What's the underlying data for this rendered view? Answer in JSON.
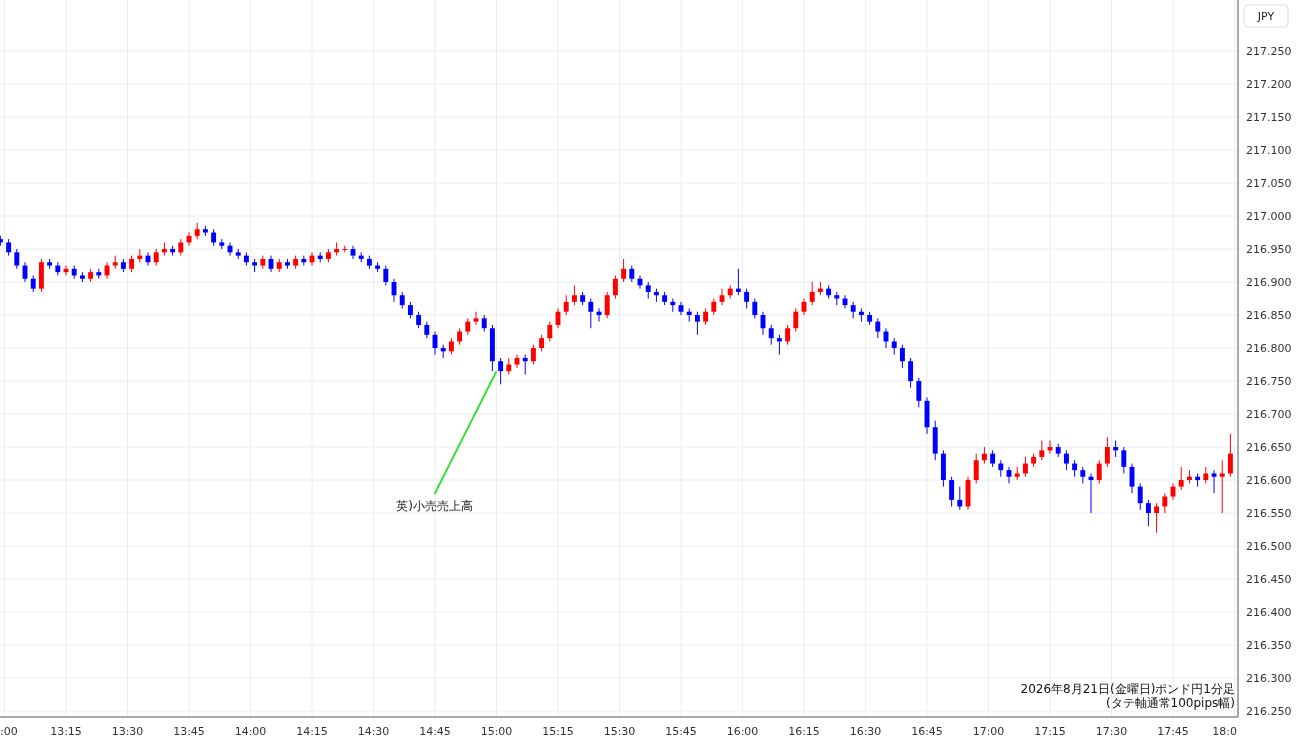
{
  "time_axis": {
    "cut_label": ":00"
  },
  "chart_data": {
    "type": "candlestick",
    "ylabel": "JPY",
    "grid": true,
    "xlim": [
      12.98167,
      18.01417
    ],
    "ylim": [
      216.241,
      217.3273
    ],
    "yticks": [
      {
        "value": 217.25,
        "label": "217.250"
      },
      {
        "value": 217.2,
        "label": "217.200"
      },
      {
        "value": 217.15,
        "label": "217.150"
      },
      {
        "value": 217.1,
        "label": "217.100"
      },
      {
        "value": 217.05,
        "label": "217.050"
      },
      {
        "value": 217.0,
        "label": "217.000"
      },
      {
        "value": 216.95,
        "label": "216.950"
      },
      {
        "value": 216.9,
        "label": "216.900"
      },
      {
        "value": 216.85,
        "label": "216.850"
      },
      {
        "value": 216.8,
        "label": "216.800"
      },
      {
        "value": 216.75,
        "label": "216.750"
      },
      {
        "value": 216.7,
        "label": "216.700"
      },
      {
        "value": 216.65,
        "label": "216.650"
      },
      {
        "value": 216.6,
        "label": "216.600"
      },
      {
        "value": 216.55,
        "label": "216.550"
      },
      {
        "value": 216.5,
        "label": "216.500"
      },
      {
        "value": 216.45,
        "label": "216.450"
      },
      {
        "value": 216.4,
        "label": "216.400"
      },
      {
        "value": 216.35,
        "label": "216.350"
      },
      {
        "value": 216.3,
        "label": "216.300"
      },
      {
        "value": 216.25,
        "label": "216.250"
      }
    ],
    "xticks": [
      {
        "value": 13.25,
        "label": "13:15"
      },
      {
        "value": 13.5,
        "label": "13:30"
      },
      {
        "value": 13.75,
        "label": "13:45"
      },
      {
        "value": 14,
        "label": "14:00"
      },
      {
        "value": 14.25,
        "label": "14:15"
      },
      {
        "value": 14.5,
        "label": "14:30"
      },
      {
        "value": 14.75,
        "label": "14:45"
      },
      {
        "value": 15,
        "label": "15:00"
      },
      {
        "value": 15.25,
        "label": "15:15"
      },
      {
        "value": 15.5,
        "label": "15:30"
      },
      {
        "value": 15.75,
        "label": "15:45"
      },
      {
        "value": 16,
        "label": "16:00"
      },
      {
        "value": 16.25,
        "label": "16:15"
      },
      {
        "value": 16.5,
        "label": "16:30"
      },
      {
        "value": 16.75,
        "label": "16:45"
      },
      {
        "value": 17,
        "label": "17:00"
      },
      {
        "value": 17.25,
        "label": "17:15"
      },
      {
        "value": 17.5,
        "label": "17:30"
      },
      {
        "value": 17.75,
        "label": "17:45"
      },
      {
        "value": 18,
        "label": "18:0"
      }
    ],
    "x": [
      12.9833,
      13.0167,
      13.05,
      13.0833,
      13.1167,
      13.15,
      13.1833,
      13.2167,
      13.25,
      13.2833,
      13.3167,
      13.35,
      13.3833,
      13.4167,
      13.45,
      13.4833,
      13.5167,
      13.55,
      13.5833,
      13.6167,
      13.65,
      13.6833,
      13.7167,
      13.75,
      13.7833,
      13.8167,
      13.85,
      13.8833,
      13.9167,
      13.95,
      13.9833,
      14.0167,
      14.05,
      14.0833,
      14.1167,
      14.15,
      14.1833,
      14.2167,
      14.25,
      14.2833,
      14.3167,
      14.35,
      14.3833,
      14.4167,
      14.45,
      14.4833,
      14.5167,
      14.55,
      14.5833,
      14.6167,
      14.65,
      14.6833,
      14.7167,
      14.75,
      14.7833,
      14.8167,
      14.85,
      14.8833,
      14.9167,
      14.95,
      14.9833,
      15.0167,
      15.05,
      15.0833,
      15.1167,
      15.15,
      15.1833,
      15.2167,
      15.25,
      15.2833,
      15.3167,
      15.35,
      15.3833,
      15.4167,
      15.45,
      15.4833,
      15.5167,
      15.55,
      15.5833,
      15.6167,
      15.65,
      15.6833,
      15.7167,
      15.75,
      15.7833,
      15.8167,
      15.85,
      15.8833,
      15.9167,
      15.95,
      15.9833,
      16.0167,
      16.05,
      16.0833,
      16.1167,
      16.15,
      16.1833,
      16.2167,
      16.25,
      16.2833,
      16.3167,
      16.35,
      16.3833,
      16.4167,
      16.45,
      16.4833,
      16.5167,
      16.55,
      16.5833,
      16.6167,
      16.65,
      16.6833,
      16.7167,
      16.75,
      16.7833,
      16.8167,
      16.85,
      16.8833,
      16.9167,
      16.95,
      16.9833,
      17.0167,
      17.05,
      17.0833,
      17.1167,
      17.15,
      17.1833,
      17.2167,
      17.25,
      17.2833,
      17.3167,
      17.35,
      17.3833,
      17.4167,
      17.45,
      17.4833,
      17.5167,
      17.55,
      17.5833,
      17.6167,
      17.65,
      17.6833,
      17.7167,
      17.75,
      17.7833,
      17.8167,
      17.85,
      17.8833,
      17.9167,
      17.95,
      17.9833
    ],
    "ohlc": [
      [
        216.965,
        216.97,
        216.955,
        216.96
      ],
      [
        216.96,
        216.965,
        216.94,
        216.945
      ],
      [
        216.945,
        216.95,
        216.92,
        216.925
      ],
      [
        216.925,
        216.93,
        216.9,
        216.905
      ],
      [
        216.905,
        216.91,
        216.885,
        216.89
      ],
      [
        216.89,
        216.935,
        216.885,
        216.93
      ],
      [
        216.93,
        216.935,
        216.92,
        216.925
      ],
      [
        216.925,
        216.93,
        216.91,
        216.915
      ],
      [
        216.915,
        216.925,
        216.91,
        216.92
      ],
      [
        216.92,
        216.925,
        216.905,
        216.91
      ],
      [
        216.91,
        216.915,
        216.9,
        216.905
      ],
      [
        216.905,
        216.92,
        216.9,
        216.915
      ],
      [
        216.915,
        216.92,
        216.905,
        216.91
      ],
      [
        216.91,
        216.93,
        216.905,
        216.925
      ],
      [
        216.925,
        216.94,
        216.92,
        216.93
      ],
      [
        216.93,
        216.935,
        216.915,
        216.92
      ],
      [
        216.92,
        216.94,
        216.915,
        216.935
      ],
      [
        216.935,
        216.95,
        216.93,
        216.94
      ],
      [
        216.94,
        216.945,
        216.925,
        216.93
      ],
      [
        216.93,
        216.95,
        216.925,
        216.945
      ],
      [
        216.945,
        216.96,
        216.94,
        216.95
      ],
      [
        216.95,
        216.955,
        216.94,
        216.945
      ],
      [
        216.945,
        216.965,
        216.94,
        216.96
      ],
      [
        216.96,
        216.975,
        216.955,
        216.97
      ],
      [
        216.97,
        216.99,
        216.965,
        216.98
      ],
      [
        216.98,
        216.985,
        216.97,
        216.975
      ],
      [
        216.975,
        216.98,
        216.955,
        216.96
      ],
      [
        216.96,
        216.965,
        216.95,
        216.955
      ],
      [
        216.955,
        216.96,
        216.94,
        216.945
      ],
      [
        216.945,
        216.95,
        216.935,
        216.94
      ],
      [
        216.94,
        216.945,
        216.925,
        216.93
      ],
      [
        216.93,
        216.935,
        216.915,
        216.925
      ],
      [
        216.925,
        216.94,
        216.92,
        216.935
      ],
      [
        216.935,
        216.94,
        216.915,
        216.92
      ],
      [
        216.92,
        216.935,
        216.915,
        216.93
      ],
      [
        216.93,
        216.935,
        216.92,
        216.925
      ],
      [
        216.925,
        216.94,
        216.92,
        216.935
      ],
      [
        216.935,
        216.94,
        216.925,
        216.93
      ],
      [
        216.93,
        216.945,
        216.925,
        216.94
      ],
      [
        216.94,
        216.945,
        216.93,
        216.935
      ],
      [
        216.935,
        216.95,
        216.93,
        216.945
      ],
      [
        216.945,
        216.96,
        216.94,
        216.95
      ],
      [
        216.95,
        216.955,
        216.945,
        216.95
      ],
      [
        216.95,
        216.955,
        216.935,
        216.94
      ],
      [
        216.94,
        216.945,
        216.93,
        216.935
      ],
      [
        216.935,
        216.94,
        216.92,
        216.925
      ],
      [
        216.925,
        216.93,
        216.915,
        216.92
      ],
      [
        216.92,
        216.925,
        216.895,
        216.9
      ],
      [
        216.9,
        216.905,
        216.87,
        216.88
      ],
      [
        216.88,
        216.885,
        216.86,
        216.865
      ],
      [
        216.865,
        216.87,
        216.845,
        216.85
      ],
      [
        216.85,
        216.855,
        216.83,
        216.835
      ],
      [
        216.835,
        216.84,
        216.815,
        216.82
      ],
      [
        216.82,
        216.825,
        216.79,
        216.8
      ],
      [
        216.8,
        216.805,
        216.785,
        216.795
      ],
      [
        216.795,
        216.815,
        216.79,
        216.81
      ],
      [
        216.81,
        216.83,
        216.805,
        216.825
      ],
      [
        216.825,
        216.845,
        216.82,
        216.84
      ],
      [
        216.84,
        216.855,
        216.835,
        216.845
      ],
      [
        216.845,
        216.85,
        216.825,
        216.83
      ],
      [
        216.83,
        216.835,
        216.765,
        216.78
      ],
      [
        216.78,
        216.785,
        216.745,
        216.765
      ],
      [
        216.765,
        216.785,
        216.76,
        216.775
      ],
      [
        216.775,
        216.79,
        216.77,
        216.785
      ],
      [
        216.785,
        216.79,
        216.76,
        216.78
      ],
      [
        216.78,
        216.805,
        216.775,
        216.8
      ],
      [
        216.8,
        216.82,
        216.795,
        216.815
      ],
      [
        216.815,
        216.84,
        216.81,
        216.835
      ],
      [
        216.835,
        216.86,
        216.83,
        216.855
      ],
      [
        216.855,
        216.88,
        216.85,
        216.87
      ],
      [
        216.87,
        216.895,
        216.865,
        216.88
      ],
      [
        216.88,
        216.885,
        216.865,
        216.87
      ],
      [
        216.87,
        216.875,
        216.83,
        216.855
      ],
      [
        216.855,
        216.86,
        216.84,
        216.85
      ],
      [
        216.85,
        216.885,
        216.845,
        216.88
      ],
      [
        216.88,
        216.91,
        216.875,
        216.905
      ],
      [
        216.905,
        216.935,
        216.9,
        216.92
      ],
      [
        216.92,
        216.925,
        216.9,
        216.905
      ],
      [
        216.905,
        216.91,
        216.89,
        216.895
      ],
      [
        216.895,
        216.9,
        216.875,
        216.885
      ],
      [
        216.885,
        216.89,
        216.87,
        216.88
      ],
      [
        216.88,
        216.885,
        216.865,
        216.87
      ],
      [
        216.87,
        216.875,
        216.855,
        216.865
      ],
      [
        216.865,
        216.87,
        216.85,
        216.855
      ],
      [
        216.855,
        216.86,
        216.84,
        216.85
      ],
      [
        216.85,
        216.855,
        216.82,
        216.84
      ],
      [
        216.84,
        216.86,
        216.835,
        216.855
      ],
      [
        216.855,
        216.875,
        216.85,
        216.87
      ],
      [
        216.87,
        216.89,
        216.865,
        216.88
      ],
      [
        216.88,
        216.895,
        216.875,
        216.89
      ],
      [
        216.89,
        216.92,
        216.88,
        216.885
      ],
      [
        216.885,
        216.89,
        216.86,
        216.87
      ],
      [
        216.87,
        216.875,
        216.845,
        216.85
      ],
      [
        216.85,
        216.855,
        216.82,
        216.83
      ],
      [
        216.83,
        216.835,
        216.805,
        216.815
      ],
      [
        216.815,
        216.82,
        216.79,
        216.81
      ],
      [
        216.81,
        216.835,
        216.805,
        216.83
      ],
      [
        216.83,
        216.86,
        216.825,
        216.855
      ],
      [
        216.855,
        216.875,
        216.85,
        216.87
      ],
      [
        216.87,
        216.9,
        216.865,
        216.885
      ],
      [
        216.885,
        216.9,
        216.88,
        216.89
      ],
      [
        216.89,
        216.895,
        216.875,
        216.88
      ],
      [
        216.88,
        216.885,
        216.865,
        216.875
      ],
      [
        216.875,
        216.88,
        216.86,
        216.865
      ],
      [
        216.865,
        216.87,
        216.845,
        216.855
      ],
      [
        216.855,
        216.86,
        216.84,
        216.85
      ],
      [
        216.85,
        216.855,
        216.835,
        216.84
      ],
      [
        216.84,
        216.845,
        216.815,
        216.825
      ],
      [
        216.825,
        216.83,
        216.8,
        216.81
      ],
      [
        216.81,
        216.815,
        216.79,
        216.8
      ],
      [
        216.8,
        216.805,
        216.77,
        216.78
      ],
      [
        216.78,
        216.785,
        216.74,
        216.75
      ],
      [
        216.75,
        216.755,
        216.71,
        216.72
      ],
      [
        216.72,
        216.725,
        216.67,
        216.68
      ],
      [
        216.68,
        216.69,
        216.63,
        216.64
      ],
      [
        216.64,
        216.645,
        216.59,
        216.6
      ],
      [
        216.6,
        216.605,
        216.56,
        216.57
      ],
      [
        216.57,
        216.59,
        216.555,
        216.56
      ],
      [
        216.56,
        216.605,
        216.555,
        216.6
      ],
      [
        216.6,
        216.64,
        216.595,
        216.63
      ],
      [
        216.63,
        216.65,
        216.625,
        216.64
      ],
      [
        216.64,
        216.645,
        216.62,
        216.625
      ],
      [
        216.625,
        216.63,
        216.605,
        216.615
      ],
      [
        216.615,
        216.62,
        216.595,
        216.605
      ],
      [
        216.605,
        216.62,
        216.6,
        216.61
      ],
      [
        216.61,
        216.635,
        216.605,
        216.625
      ],
      [
        216.625,
        216.64,
        216.62,
        216.635
      ],
      [
        216.635,
        216.66,
        216.63,
        216.645
      ],
      [
        216.645,
        216.66,
        216.64,
        216.65
      ],
      [
        216.65,
        216.655,
        216.635,
        216.64
      ],
      [
        216.64,
        216.645,
        216.615,
        216.625
      ],
      [
        216.625,
        216.63,
        216.605,
        216.615
      ],
      [
        216.615,
        216.62,
        216.595,
        216.605
      ],
      [
        216.605,
        216.61,
        216.55,
        216.6
      ],
      [
        216.6,
        216.63,
        216.595,
        216.625
      ],
      [
        216.625,
        216.665,
        216.62,
        216.65
      ],
      [
        216.65,
        216.66,
        216.635,
        216.645
      ],
      [
        216.645,
        216.65,
        216.61,
        216.62
      ],
      [
        216.62,
        216.625,
        216.58,
        216.59
      ],
      [
        216.59,
        216.595,
        216.555,
        216.565
      ],
      [
        216.565,
        216.57,
        216.53,
        216.55
      ],
      [
        216.55,
        216.565,
        216.52,
        216.56
      ],
      [
        216.56,
        216.58,
        216.55,
        216.575
      ],
      [
        216.575,
        216.595,
        216.57,
        216.59
      ],
      [
        216.59,
        216.62,
        216.585,
        216.6
      ],
      [
        216.6,
        216.615,
        216.595,
        216.605
      ],
      [
        216.605,
        216.61,
        216.59,
        216.6
      ],
      [
        216.6,
        216.62,
        216.595,
        216.61
      ],
      [
        216.61,
        216.615,
        216.58,
        216.605
      ],
      [
        216.605,
        216.63,
        216.55,
        216.61
      ],
      [
        216.61,
        216.67,
        216.605,
        216.64
      ]
    ],
    "annotations": [
      {
        "text": "英)小売売上高",
        "x": 15.0,
        "y": 216.765
      }
    ]
  },
  "caption": {
    "lines": [
      "2026年8月21日(金曜日)ポンド円1分足",
      "(タテ軸通常100pips幅)"
    ]
  }
}
